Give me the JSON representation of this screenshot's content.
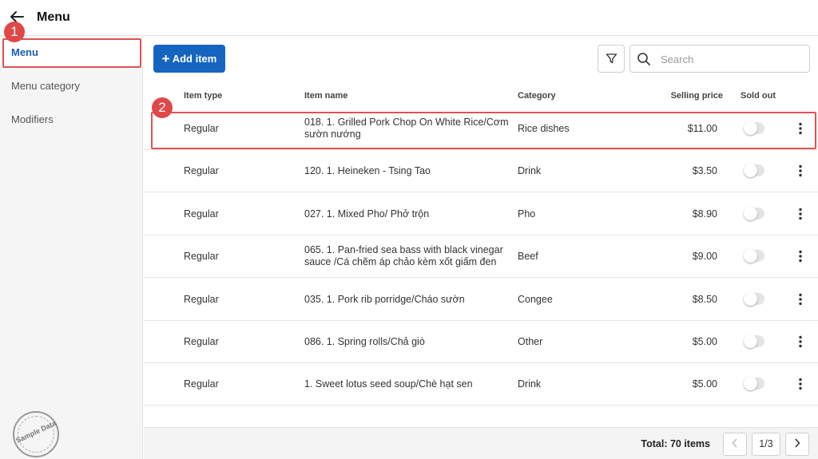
{
  "header": {
    "title": "Menu"
  },
  "sidebar": {
    "items": [
      {
        "label": "Menu"
      },
      {
        "label": "Menu category"
      },
      {
        "label": "Modifiers"
      }
    ],
    "stamp_text": "Sample Data"
  },
  "annotations": {
    "badge1": "1",
    "badge2": "2"
  },
  "toolbar": {
    "add_label": "Add item",
    "search_placeholder": "Search"
  },
  "table": {
    "headers": {
      "item_type": "Item type",
      "item_name": "Item name",
      "category": "Category",
      "selling_price": "Selling price",
      "sold_out": "Sold out"
    },
    "rows": [
      {
        "type": "Regular",
        "name": "018. 1. Grilled Pork Chop On White Rice/Cơm sườn nướng",
        "category": "Rice dishes",
        "price": "$11.00",
        "sold_out": false
      },
      {
        "type": "Regular",
        "name": "120. 1. Heineken - Tsing Tao",
        "category": "Drink",
        "price": "$3.50",
        "sold_out": false
      },
      {
        "type": "Regular",
        "name": "027. 1. Mixed Pho/ Phở trộn",
        "category": "Pho",
        "price": "$8.90",
        "sold_out": false
      },
      {
        "type": "Regular",
        "name": "065. 1. Pan-fried sea bass with black vinegar sauce /Cá chẽm áp chảo kèm xốt giấm đen",
        "category": "Beef",
        "price": "$9.00",
        "sold_out": false
      },
      {
        "type": "Regular",
        "name": "035. 1. Pork rib porridge/Cháo sườn",
        "category": "Congee",
        "price": "$8.50",
        "sold_out": false
      },
      {
        "type": "Regular",
        "name": "086. 1. Spring rolls/Chả giò",
        "category": "Other",
        "price": "$5.00",
        "sold_out": false
      },
      {
        "type": "Regular",
        "name": "1. Sweet lotus seed soup/Chè hạt sen",
        "category": "Drink",
        "price": "$5.00",
        "sold_out": false
      }
    ]
  },
  "footer": {
    "total": "Total: 70 items",
    "page": "1/3"
  },
  "colors": {
    "accent": "#1565c0",
    "highlight": "#e05252",
    "sidebar_bg": "#f5f5f5"
  }
}
